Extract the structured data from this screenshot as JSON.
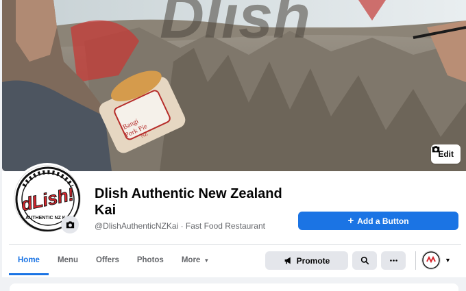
{
  "cover": {
    "edit_label": "Edit",
    "watermark_text": "Dlish",
    "pie_label_line1": "Bangi",
    "pie_label_line2": "Pork Pie",
    "pie_label_line3": "NZ"
  },
  "page": {
    "name": "Dlish Authentic New Zealand Kai",
    "handle": "@DlishAuthenticNZKai",
    "separator": " · ",
    "category": "Fast Food Restaurant",
    "logo_text": "dLish!",
    "logo_ring_text": "AUTHENTIC NZ KAI"
  },
  "primary_action": {
    "label": "Add a Button",
    "icon": "plus-icon"
  },
  "tabs": [
    {
      "label": "Home",
      "active": true
    },
    {
      "label": "Menu",
      "active": false
    },
    {
      "label": "Offers",
      "active": false
    },
    {
      "label": "Photos",
      "active": false
    },
    {
      "label": "More",
      "active": false
    }
  ],
  "actions": {
    "promote_label": "Promote",
    "search_icon": "search-icon",
    "more_icon": "ellipsis-icon"
  },
  "colors": {
    "accent": "#1b74e4",
    "brand_red": "#d7282f",
    "secondary_button": "#e4e6eb",
    "muted_text": "#65676b"
  }
}
